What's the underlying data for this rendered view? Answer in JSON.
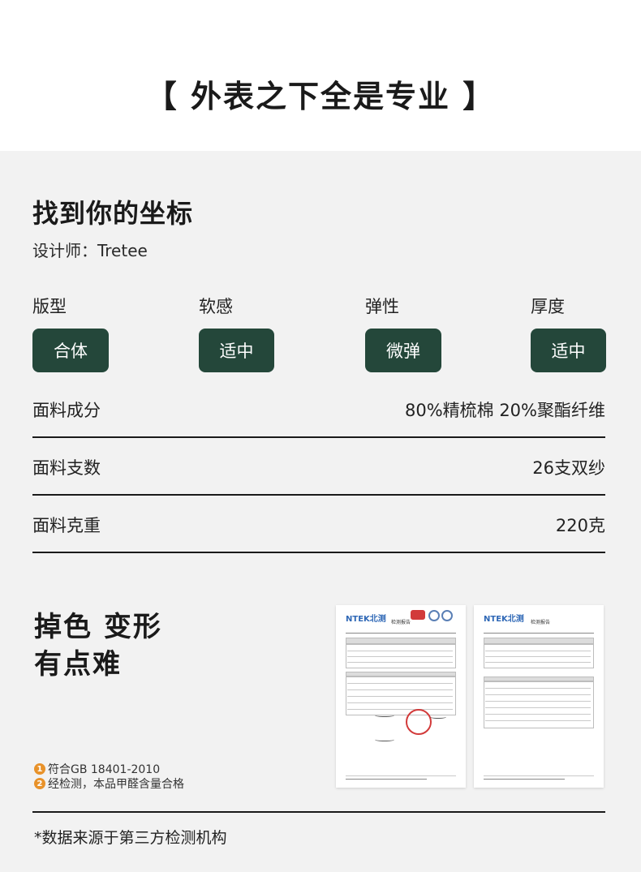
{
  "header": {
    "title": "【 外表之下全是专业 】"
  },
  "product": {
    "title": "找到你的坐标",
    "designer": "设计师：Tretee"
  },
  "attributes": [
    {
      "label": "版型",
      "value": "合体"
    },
    {
      "label": "软感",
      "value": "适中"
    },
    {
      "label": "弹性",
      "value": "微弹"
    },
    {
      "label": "厚度",
      "value": "适中"
    }
  ],
  "specs": [
    {
      "label": "面料成分",
      "value": "80%精梳棉 20%聚酯纤维"
    },
    {
      "label": "面料支数",
      "value": "26支双纱"
    },
    {
      "label": "面料克重",
      "value": "220克"
    }
  ],
  "test": {
    "headline_line1": "掉色 变形",
    "headline_line2": "有点难",
    "notes": [
      {
        "num": "1",
        "text": "符合GB 18401-2010"
      },
      {
        "num": "2",
        "text": "经检测，本品甲醛含量合格"
      }
    ],
    "report_logo": "NTEK北测",
    "report_title": "检测报告"
  },
  "footer": {
    "source": "*数据来源于第三方检测机构"
  }
}
